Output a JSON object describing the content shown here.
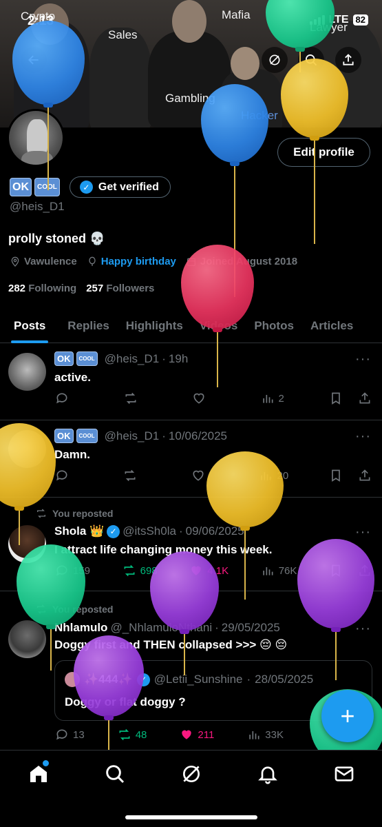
{
  "status_bar": {
    "time": "2:13",
    "network": "LTE",
    "battery": "82"
  },
  "banner": {
    "words": [
      "Crypto",
      "Sales",
      "Mafia",
      "Lawyer",
      "Gambling",
      "Hacker"
    ]
  },
  "header_buttons": {
    "back": "back-icon",
    "grok": "grok-icon",
    "search": "search-icon",
    "share": "share-icon"
  },
  "profile": {
    "name_emoji_1": "OK",
    "name_emoji_2": "COOL",
    "verify_label": "Get verified",
    "edit_label": "Edit profile",
    "handle": "@heis_D1",
    "bio": "prolly stoned 💀",
    "location": "Vawulence",
    "birthday": "Happy birthday",
    "joined": "Joined August 2018",
    "following_count": "282",
    "following_label": "Following",
    "followers_count": "257",
    "followers_label": "Followers"
  },
  "tabs": [
    "Posts",
    "Replies",
    "Highlights",
    "Videos",
    "Photos",
    "Articles"
  ],
  "posts": [
    {
      "handle": "@heis_D1",
      "time": "19h",
      "text": "active.",
      "replies": "",
      "reposts": "",
      "likes": "",
      "views": "2"
    },
    {
      "handle": "@heis_D1",
      "time": "10/06/2025",
      "text": "Damn.",
      "replies": "",
      "reposts": "",
      "likes": "",
      "views": "20"
    },
    {
      "repost_label": "You reposted",
      "name": "Shola 👑",
      "handle": "@itsSh0la",
      "time": "09/06/2025",
      "text": "I attract life changing money this week.",
      "replies": "159",
      "reposts": "698",
      "likes": "4.1K",
      "views": "76K"
    },
    {
      "repost_label": "You reposted",
      "name": "Nhlamulo",
      "handle": "@_NhlamuloNthani",
      "time": "29/05/2025",
      "text": "Doggy first and THEN collapsed >>> 😔 😔",
      "quote": {
        "name": "✨444✨",
        "handle": "@Letii_Sunshine",
        "time": "28/05/2025",
        "text": "Doggy or flat doggy ?"
      },
      "replies": "13",
      "reposts": "48",
      "likes": "211",
      "views": "33K"
    }
  ],
  "fab_label": "+",
  "nav": [
    "home-icon",
    "search-icon",
    "grok-icon",
    "notifications-icon",
    "messages-icon"
  ],
  "colors": {
    "accent": "#1d9bf0",
    "repost": "#00ba7c",
    "like": "#f91880"
  }
}
